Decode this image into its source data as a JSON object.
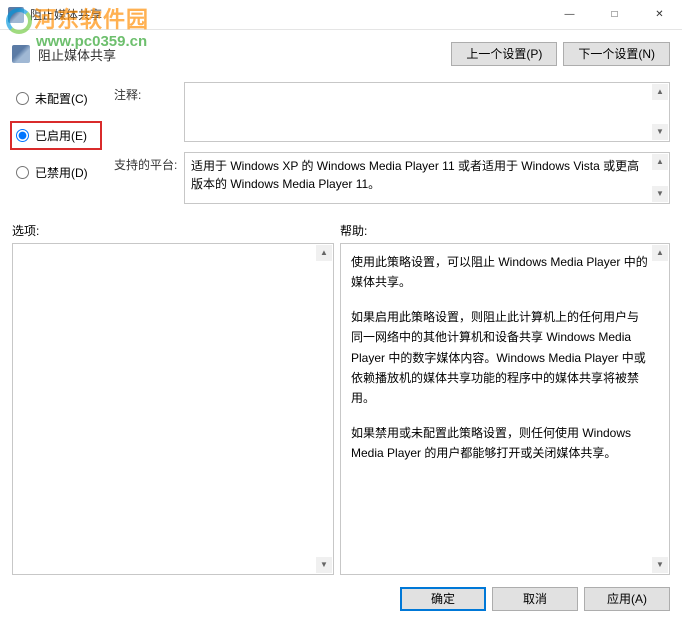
{
  "window": {
    "title": "阻止媒体共享"
  },
  "header": {
    "title": "阻止媒体共享",
    "prev_btn": "上一个设置(P)",
    "next_btn": "下一个设置(N)"
  },
  "radios": {
    "not_configured": "未配置(C)",
    "enabled": "已启用(E)",
    "disabled": "已禁用(D)",
    "selected": "enabled"
  },
  "fields": {
    "comment_label": "注释:",
    "comment_value": "",
    "platform_label": "支持的平台:",
    "platform_value": "适用于 Windows XP 的 Windows Media Player 11 或者适用于 Windows Vista 或更高版本的 Windows Media Player 11。"
  },
  "sections": {
    "options_label": "选项:",
    "help_label": "帮助:"
  },
  "help": {
    "p1": "使用此策略设置，可以阻止 Windows Media Player 中的媒体共享。",
    "p2": "如果启用此策略设置，则阻止此计算机上的任何用户与同一网络中的其他计算机和设备共享 Windows Media Player 中的数字媒体内容。Windows Media Player 中或依赖播放机的媒体共享功能的程序中的媒体共享将被禁用。",
    "p3": "如果禁用或未配置此策略设置，则任何使用 Windows Media Player 的用户都能够打开或关闭媒体共享。"
  },
  "footer": {
    "ok": "确定",
    "cancel": "取消",
    "apply": "应用(A)"
  },
  "watermark": {
    "line1": "河东软件园",
    "line2": "www.pc0359.cn"
  }
}
